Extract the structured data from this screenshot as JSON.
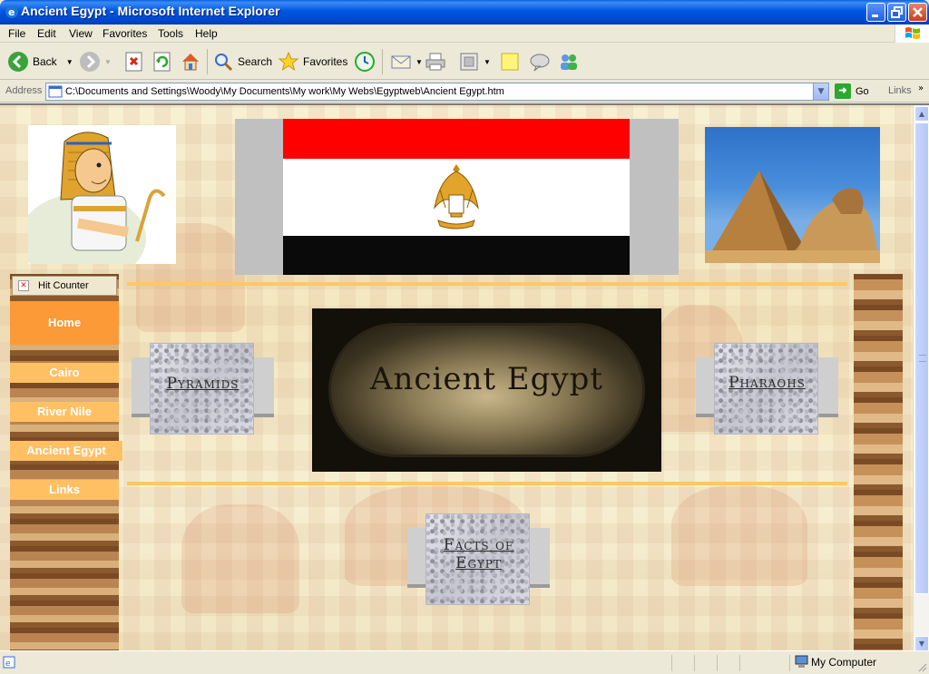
{
  "window": {
    "title": "Ancient Egypt - Microsoft Internet Explorer",
    "controls": {
      "minimize": "_",
      "maximize": "□",
      "close": "✕"
    }
  },
  "menu": [
    "File",
    "Edit",
    "View",
    "Favorites",
    "Tools",
    "Help"
  ],
  "toolbar": {
    "back_label": "Back",
    "search_label": "Search",
    "favorites_label": "Favorites"
  },
  "address": {
    "label": "Address",
    "url": "C:\\Documents and Settings\\Woody\\My Documents\\My work\\My Webs\\Egyptweb\\Ancient Egypt.htm",
    "go_label": "Go",
    "links_label": "Links"
  },
  "page": {
    "hit_counter": "Hit Counter",
    "nav": {
      "home": "Home",
      "items": [
        "Cairo",
        "River Nile",
        "Ancient Egypt",
        "Links"
      ]
    },
    "banner_text": "Ancient Egypt",
    "buttons": {
      "pyramids": "Pyramids",
      "pharaohs": "Pharaohs",
      "facts_line1": "Facts of",
      "facts_line2": "Egypt"
    },
    "colors": {
      "nav_home": "#fb9a36",
      "nav_item": "#ffc064",
      "divider": "#ffc864"
    }
  },
  "status": {
    "zone_label": "My Computer"
  }
}
